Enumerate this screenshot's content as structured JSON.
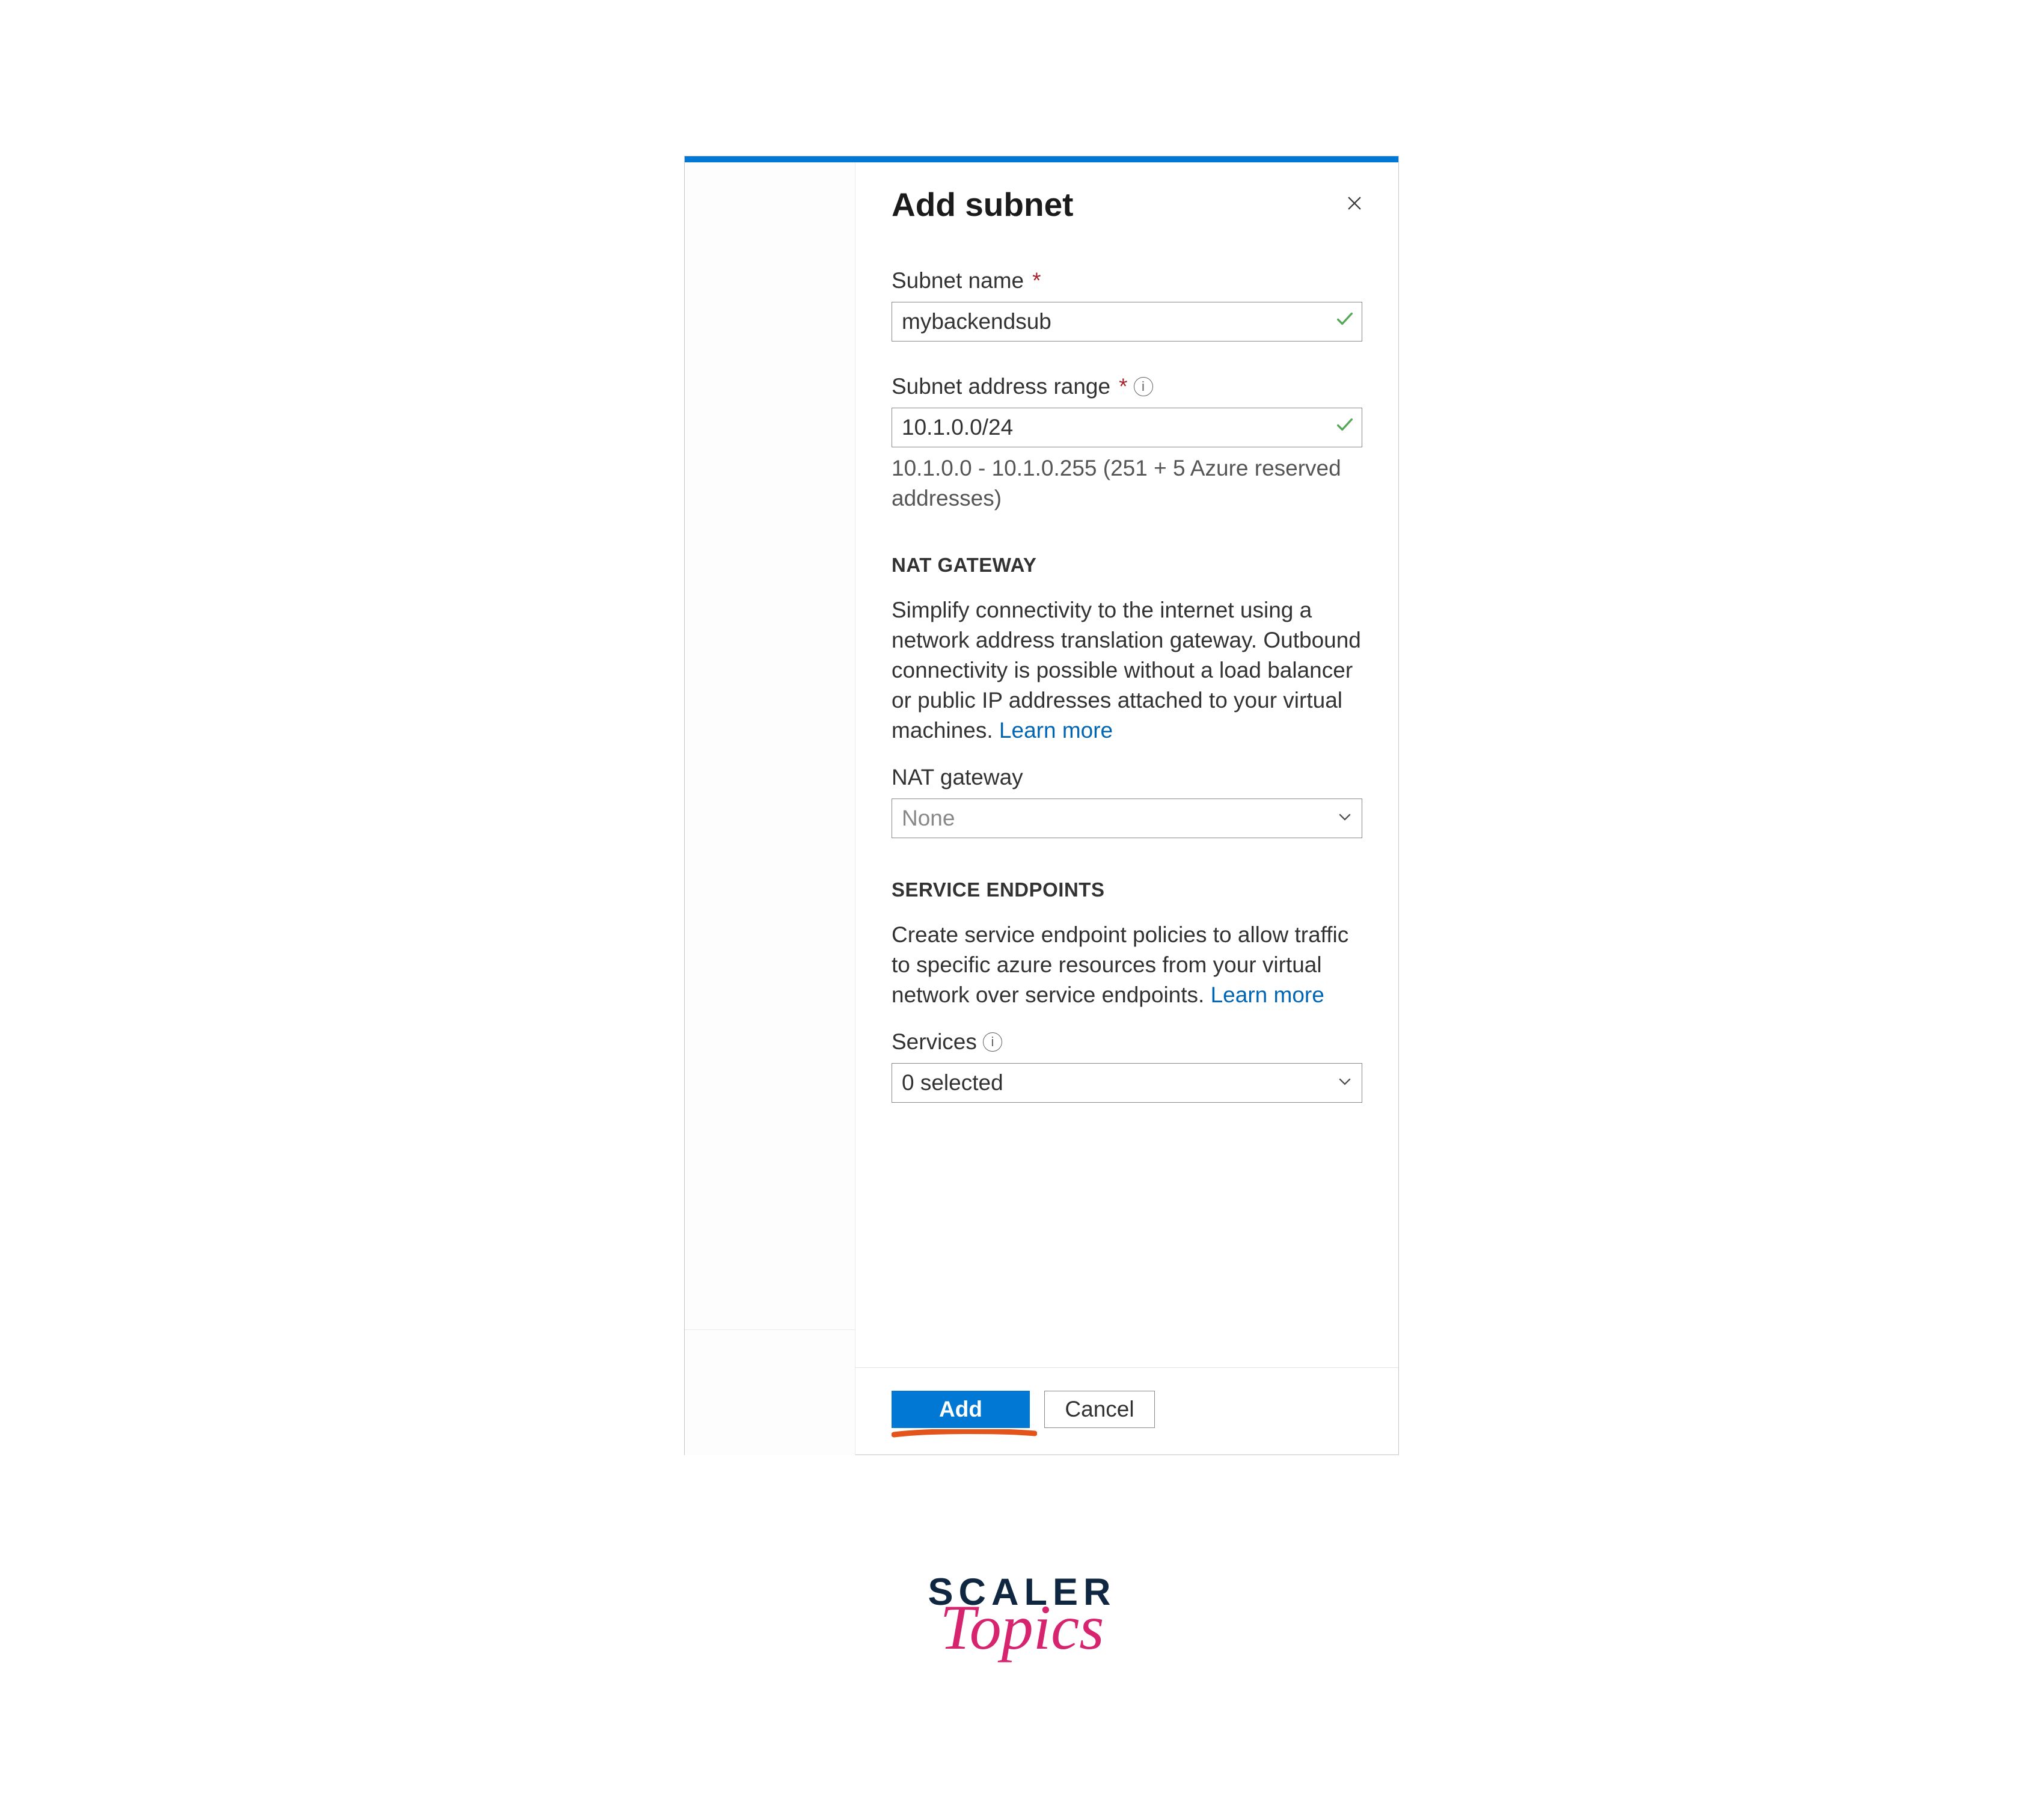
{
  "blade": {
    "title": "Add subnet",
    "close_label": "Close"
  },
  "fields": {
    "subnet_name": {
      "label": "Subnet name",
      "required_marker": "*",
      "value": "mybackendsub"
    },
    "subnet_range": {
      "label": "Subnet address range",
      "required_marker": "*",
      "value": "10.1.0.0/24",
      "helper": "10.1.0.0 - 10.1.0.255 (251 + 5 Azure reserved addresses)"
    },
    "nat_gateway_section": {
      "header": "NAT GATEWAY",
      "description": "Simplify connectivity to the internet using a network address translation gateway. Outbound connectivity is possible without a load balancer or public IP addresses attached to your virtual machines.",
      "learn_more": "Learn more"
    },
    "nat_gateway": {
      "label": "NAT gateway",
      "value": "None"
    },
    "service_endpoints_section": {
      "header": "SERVICE ENDPOINTS",
      "description": "Create service endpoint policies to allow traffic to specific azure resources from your virtual network over service endpoints.",
      "learn_more": "Learn more"
    },
    "services": {
      "label": "Services",
      "value": "0 selected"
    }
  },
  "footer": {
    "add": "Add",
    "cancel": "Cancel"
  },
  "watermark": {
    "line1": "SCALER",
    "line2": "Topics"
  }
}
